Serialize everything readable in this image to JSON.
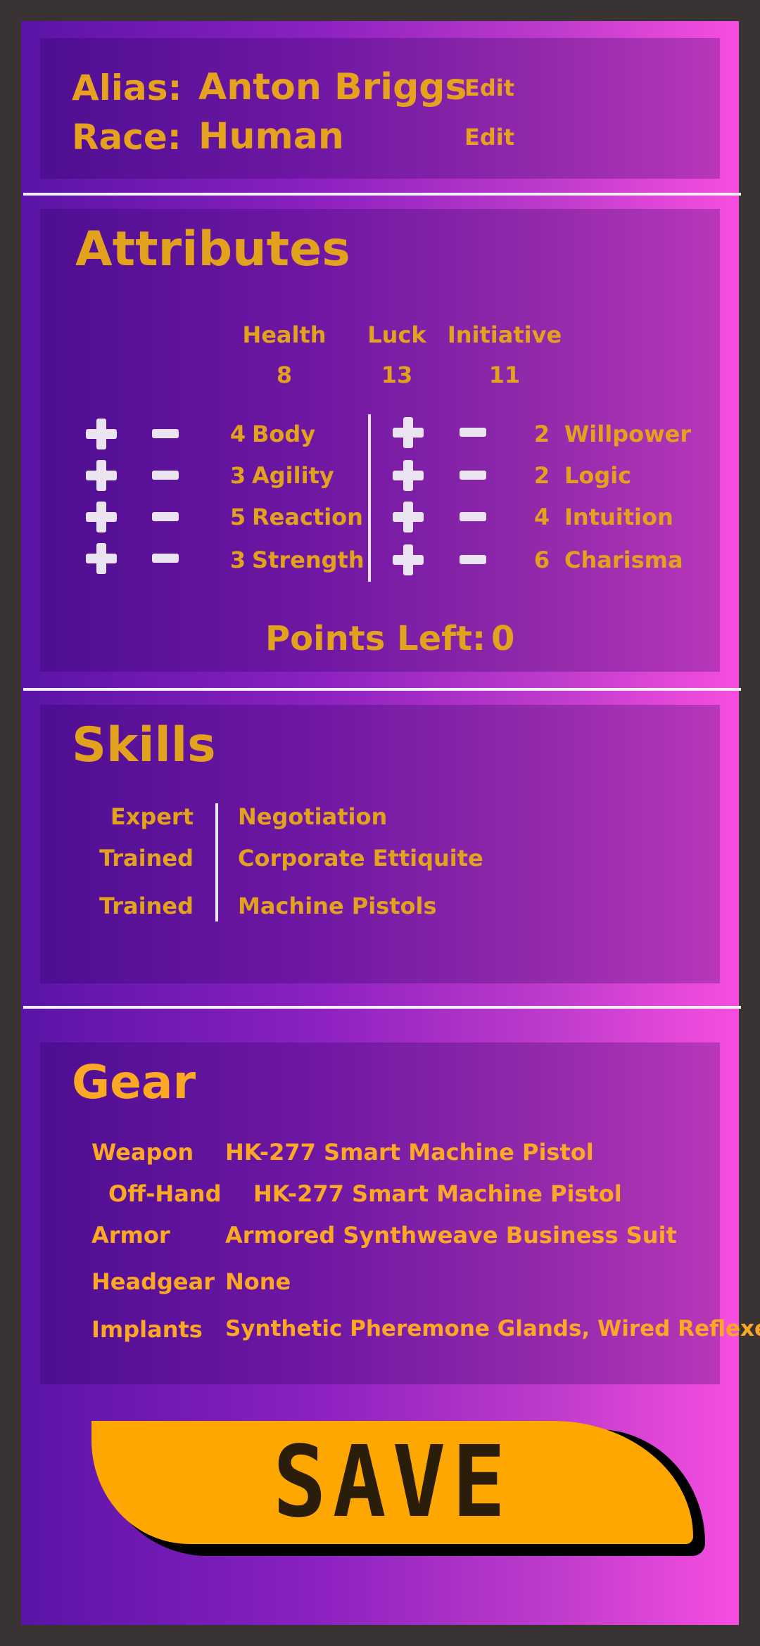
{
  "identity": {
    "alias_label": "Alias:",
    "alias_value": "Anton Briggs",
    "race_label": "Race:",
    "race_value": "Human",
    "edit_label": "Edit"
  },
  "attributes": {
    "title": "Attributes",
    "derived": [
      {
        "label": "Health",
        "value": "8"
      },
      {
        "label": "Luck",
        "value": "13"
      },
      {
        "label": "Initiative",
        "value": "11"
      }
    ],
    "left": [
      {
        "value": "4",
        "name": "Body"
      },
      {
        "value": "3",
        "name": "Agility"
      },
      {
        "value": "5",
        "name": "Reaction"
      },
      {
        "value": "3",
        "name": "Strength"
      }
    ],
    "right": [
      {
        "value": "2",
        "name": "Willpower"
      },
      {
        "value": "2",
        "name": "Logic"
      },
      {
        "value": "4",
        "name": "Intuition"
      },
      {
        "value": "6",
        "name": "Charisma"
      }
    ],
    "points_left_label": "Points Left:",
    "points_left_value": "0"
  },
  "skills": {
    "title": "Skills",
    "items": [
      {
        "level": "Expert",
        "name": "Negotiation"
      },
      {
        "level": "Trained",
        "name": "Corporate Ettiquite"
      },
      {
        "level": "Trained",
        "name": "Machine Pistols"
      }
    ]
  },
  "gear": {
    "title": "Gear",
    "items": [
      {
        "slot": "Weapon",
        "item": "HK-277 Smart Machine Pistol"
      },
      {
        "slot": "Off-Hand",
        "item": "HK-277 Smart Machine Pistol"
      },
      {
        "slot": "Armor",
        "item": "Armored Synthweave Business Suit"
      },
      {
        "slot": "Headgear",
        "item": "None"
      },
      {
        "slot": "Implants",
        "item": "Synthetic Pheremone Glands, Wired Reflexes"
      }
    ]
  },
  "save_label": "SAVE",
  "colors": {
    "accent": "#e3a21e",
    "save_button": "#ffa701",
    "frame": "#3a3333",
    "gradient_start": "#5a14a6",
    "gradient_end": "#f74ee0"
  },
  "icons": {
    "increment": "plus-icon",
    "decrement": "minus-icon"
  }
}
